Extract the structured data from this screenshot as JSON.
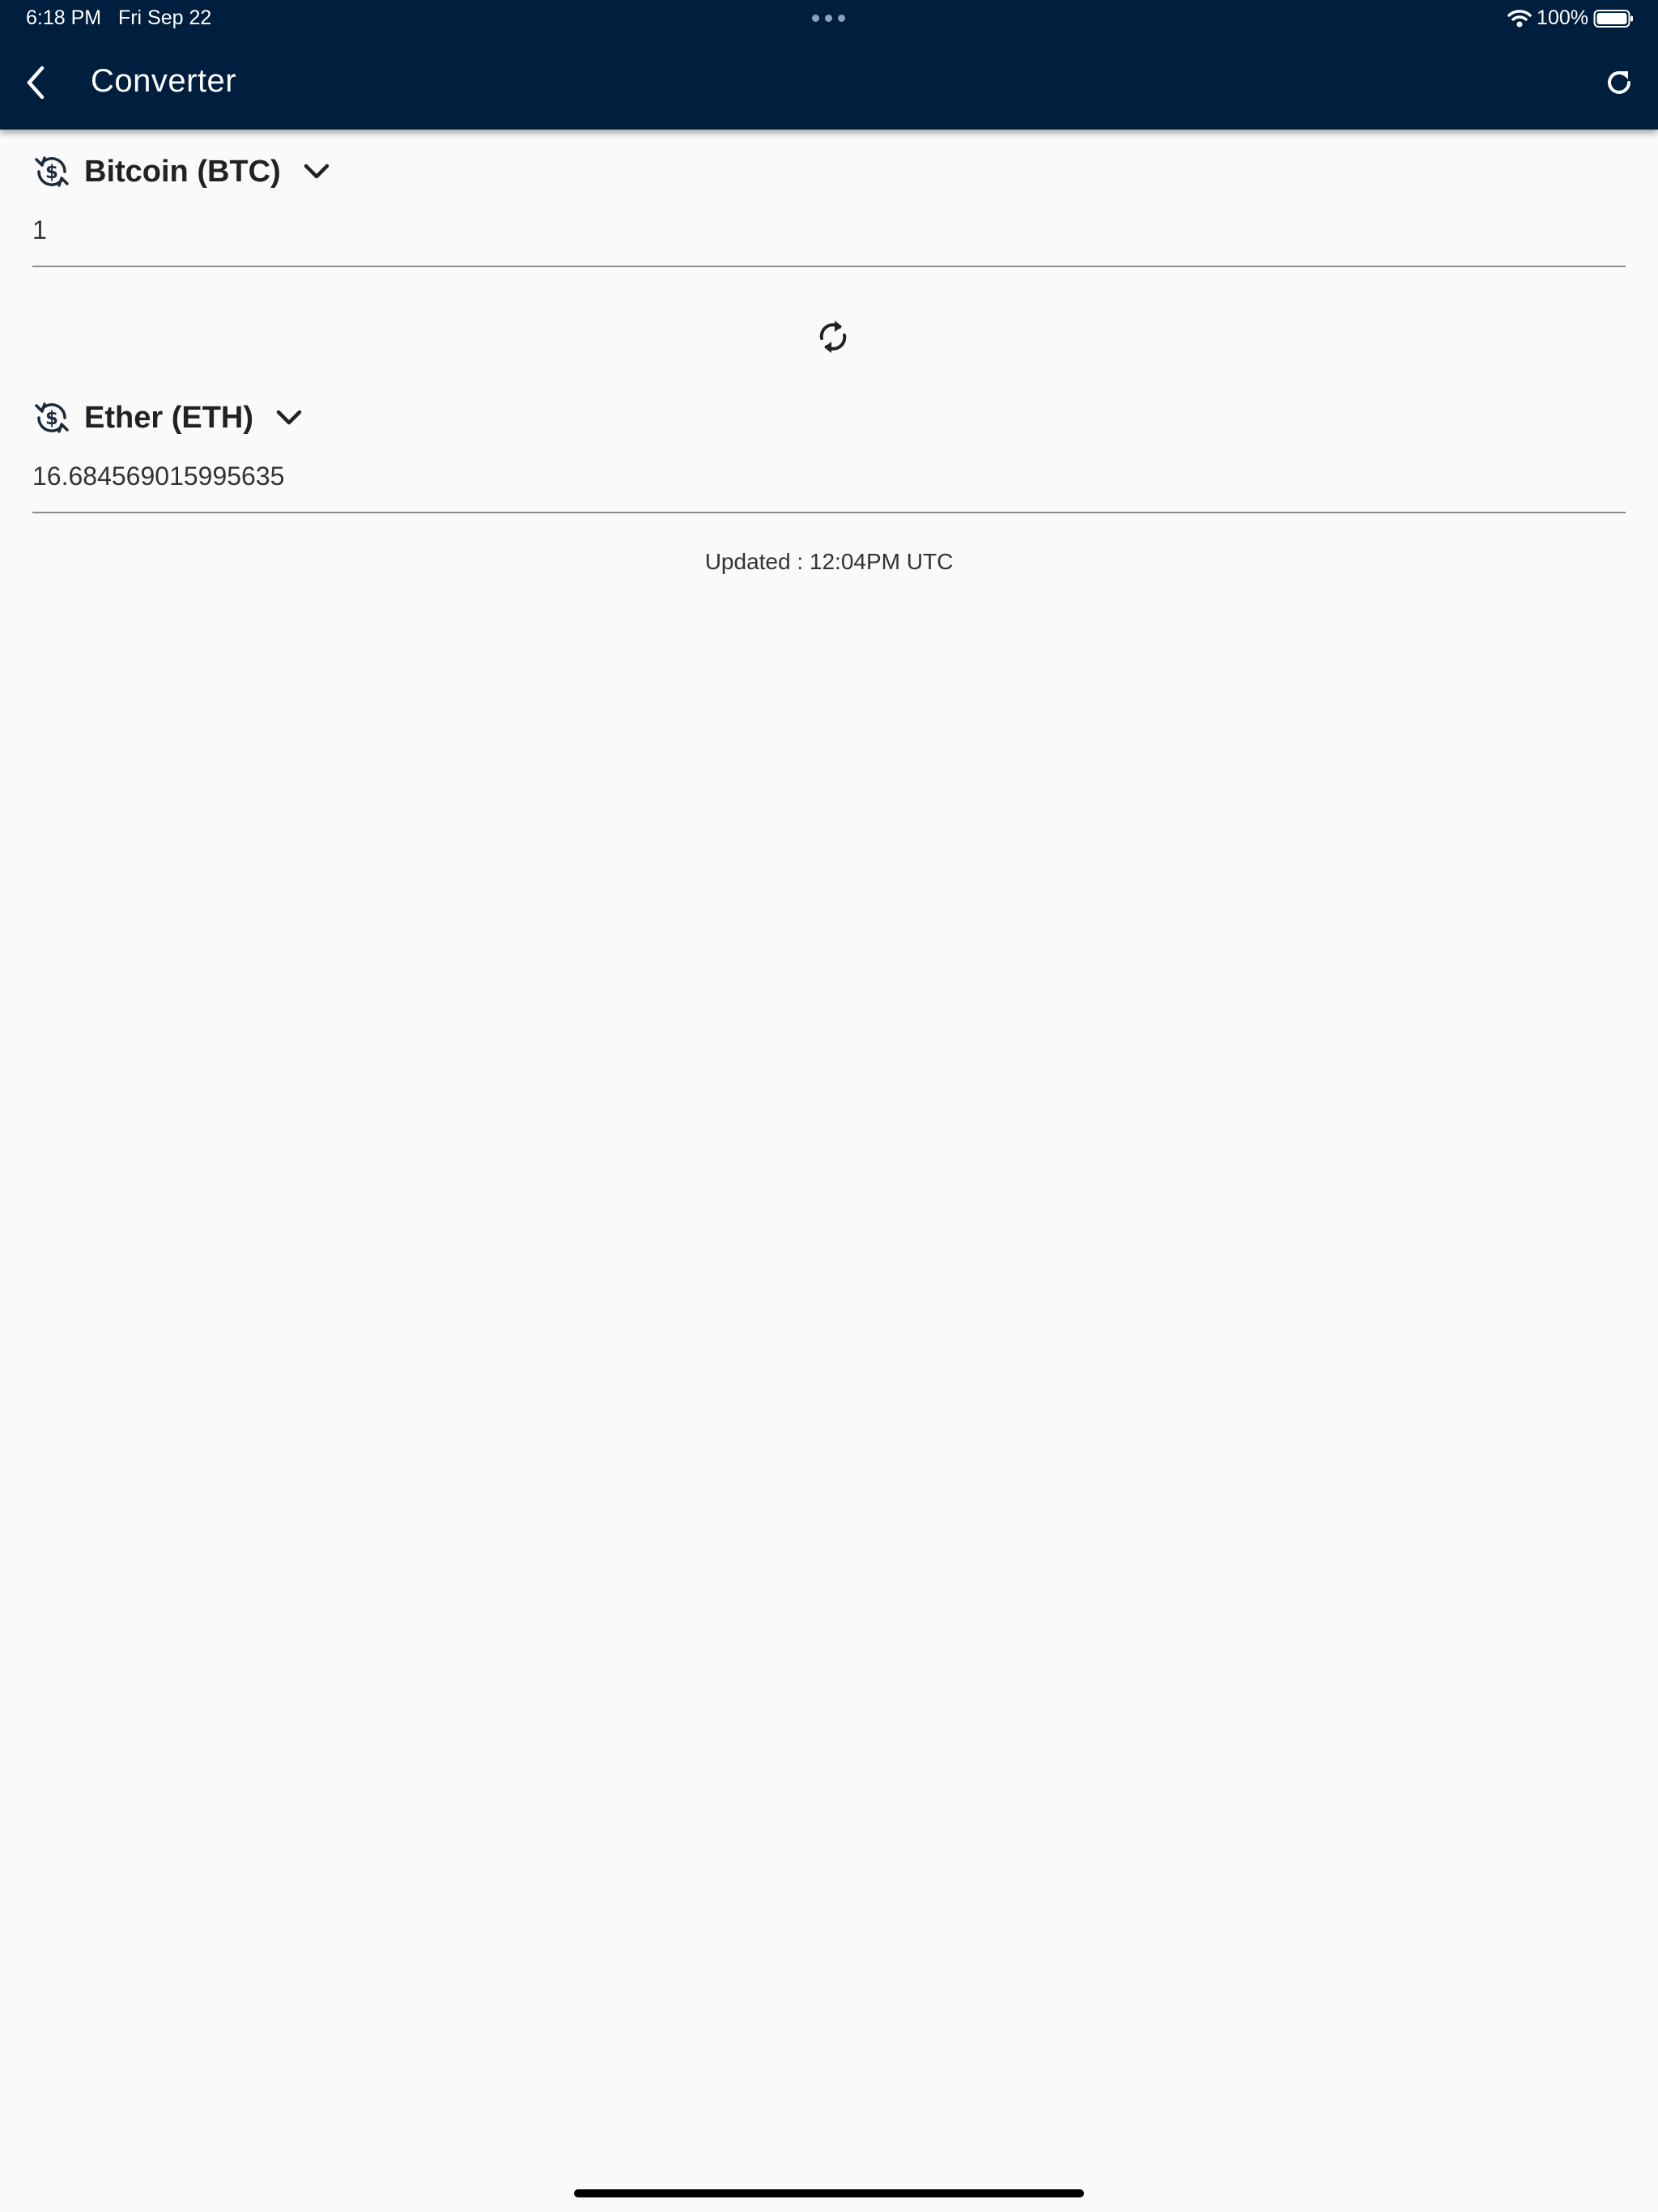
{
  "status_bar": {
    "time": "6:18 PM",
    "date": "Fri Sep 22",
    "battery": "100%"
  },
  "header": {
    "title": "Converter"
  },
  "from_currency": {
    "name": "Bitcoin (BTC)",
    "amount": "1"
  },
  "to_currency": {
    "name": "Ether (ETH)",
    "amount": "16.684569015995635"
  },
  "footer": {
    "updated": "Updated : 12:04PM UTC"
  },
  "colors": {
    "header_bg": "#001e3e",
    "page_bg": "#fafafa",
    "icon": "#1b2a3d"
  },
  "icons": {
    "back": "chevron-left-icon",
    "refresh": "refresh-icon",
    "exchange": "currency-exchange-icon",
    "dropdown": "chevron-down-icon",
    "swap": "sync-icon"
  }
}
